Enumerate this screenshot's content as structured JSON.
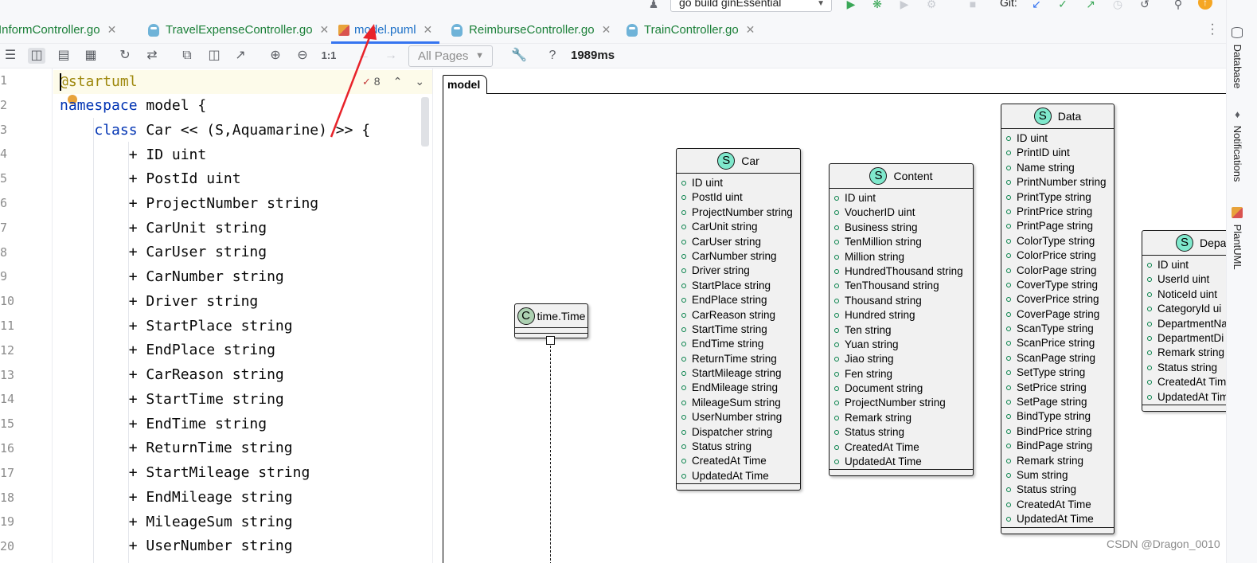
{
  "run_config": {
    "label": "go build ginEssential"
  },
  "git": {
    "label": "Git:"
  },
  "tabs": [
    {
      "label": "InformController.go",
      "type": "go",
      "active": false
    },
    {
      "label": "TravelExpenseController.go",
      "type": "go",
      "active": false
    },
    {
      "label": "model.puml",
      "type": "puml",
      "active": true
    },
    {
      "label": "ReimburseController.go",
      "type": "go",
      "active": false
    },
    {
      "label": "TrainController.go",
      "type": "go",
      "active": false
    }
  ],
  "preview_toolbar": {
    "zoom_actual_label": "1:1",
    "pages_select": "All Pages",
    "render_time": "1989ms"
  },
  "right_tools": {
    "database": "Database",
    "notifications": "Notifications",
    "plantuml": "PlantUML"
  },
  "editor": {
    "inspection_count": "8",
    "line_numbers": [
      "1",
      "2",
      "3",
      "4",
      "5",
      "6",
      "7",
      "8",
      "9",
      "10",
      "11",
      "12",
      "13",
      "14",
      "15",
      "16",
      "17",
      "18",
      "19",
      "20"
    ],
    "lines": [
      {
        "indent": "",
        "kw": "",
        "text": "@startuml"
      },
      {
        "indent": "",
        "kw": "namespace",
        "text": " model {"
      },
      {
        "indent": "    ",
        "kw": "class",
        "text": " Car << (S,Aquamarine) >> {"
      },
      {
        "indent": "        ",
        "kw": "",
        "text": "+ ID uint"
      },
      {
        "indent": "        ",
        "kw": "",
        "text": "+ PostId uint"
      },
      {
        "indent": "        ",
        "kw": "",
        "text": "+ ProjectNumber string"
      },
      {
        "indent": "        ",
        "kw": "",
        "text": "+ CarUnit string"
      },
      {
        "indent": "        ",
        "kw": "",
        "text": "+ CarUser string"
      },
      {
        "indent": "        ",
        "kw": "",
        "text": "+ CarNumber string"
      },
      {
        "indent": "        ",
        "kw": "",
        "text": "+ Driver string"
      },
      {
        "indent": "        ",
        "kw": "",
        "text": "+ StartPlace string"
      },
      {
        "indent": "        ",
        "kw": "",
        "text": "+ EndPlace string"
      },
      {
        "indent": "        ",
        "kw": "",
        "text": "+ CarReason string"
      },
      {
        "indent": "        ",
        "kw": "",
        "text": "+ StartTime string"
      },
      {
        "indent": "        ",
        "kw": "",
        "text": "+ EndTime string"
      },
      {
        "indent": "        ",
        "kw": "",
        "text": "+ ReturnTime string"
      },
      {
        "indent": "        ",
        "kw": "",
        "text": "+ StartMileage string"
      },
      {
        "indent": "        ",
        "kw": "",
        "text": "+ EndMileage string"
      },
      {
        "indent": "        ",
        "kw": "",
        "text": "+ MileageSum string"
      },
      {
        "indent": "        ",
        "kw": "",
        "text": "+ UserNumber string"
      }
    ]
  },
  "diagram": {
    "package_label": "model",
    "classes": [
      {
        "id": "time",
        "stereotype": "C",
        "name": "time.Time",
        "fields": []
      },
      {
        "id": "car",
        "stereotype": "S",
        "name": "Car",
        "fields": [
          "ID uint",
          "PostId uint",
          "ProjectNumber string",
          "CarUnit string",
          "CarUser string",
          "CarNumber string",
          "Driver string",
          "StartPlace string",
          "EndPlace string",
          "CarReason string",
          "StartTime string",
          "EndTime string",
          "ReturnTime string",
          "StartMileage string",
          "EndMileage string",
          "MileageSum string",
          "UserNumber string",
          "Dispatcher string",
          "Status string",
          "CreatedAt Time",
          "UpdatedAt Time"
        ]
      },
      {
        "id": "content",
        "stereotype": "S",
        "name": "Content",
        "fields": [
          "ID uint",
          "VoucherID uint",
          "Business string",
          "TenMillion string",
          "Million string",
          "HundredThousand string",
          "TenThousand string",
          "Thousand string",
          "Hundred string",
          "Ten string",
          "Yuan string",
          "Jiao string",
          "Fen string",
          "Document string",
          "ProjectNumber string",
          "Remark string",
          "Status string",
          "CreatedAt Time",
          "UpdatedAt Time"
        ]
      },
      {
        "id": "data",
        "stereotype": "S",
        "name": "Data",
        "fields": [
          "ID uint",
          "PrintID uint",
          "Name string",
          "PrintNumber string",
          "PrintType string",
          "PrintPrice string",
          "PrintPage string",
          "ColorType string",
          "ColorPrice string",
          "ColorPage string",
          "CoverType string",
          "CoverPrice string",
          "CoverPage string",
          "ScanType string",
          "ScanPrice string",
          "ScanPage string",
          "SetType string",
          "SetPrice string",
          "SetPage string",
          "BindType string",
          "BindPrice string",
          "BindPage string",
          "Remark string",
          "Sum string",
          "Status string",
          "CreatedAt Time",
          "UpdatedAt Time"
        ]
      },
      {
        "id": "department",
        "stereotype": "S",
        "name": "Depa",
        "fields": [
          "ID uint",
          "UserId uint",
          "NoticeId uint",
          "CategoryId ui",
          "DepartmentNa",
          "DepartmentDi",
          "Remark string",
          "Status string",
          "CreatedAt Tim",
          "UpdatedAt Tim"
        ]
      }
    ]
  },
  "watermark": "CSDN @Dragon_0010",
  "colors": {
    "keyword": "#0033b3",
    "annotation": "#9e880d",
    "tab_active": "#1b6fc7",
    "tab_text": "#1a7f37",
    "struct_badge": "#7fe8cc",
    "class_badge": "#add1b2",
    "arrow": "#e8232a"
  }
}
